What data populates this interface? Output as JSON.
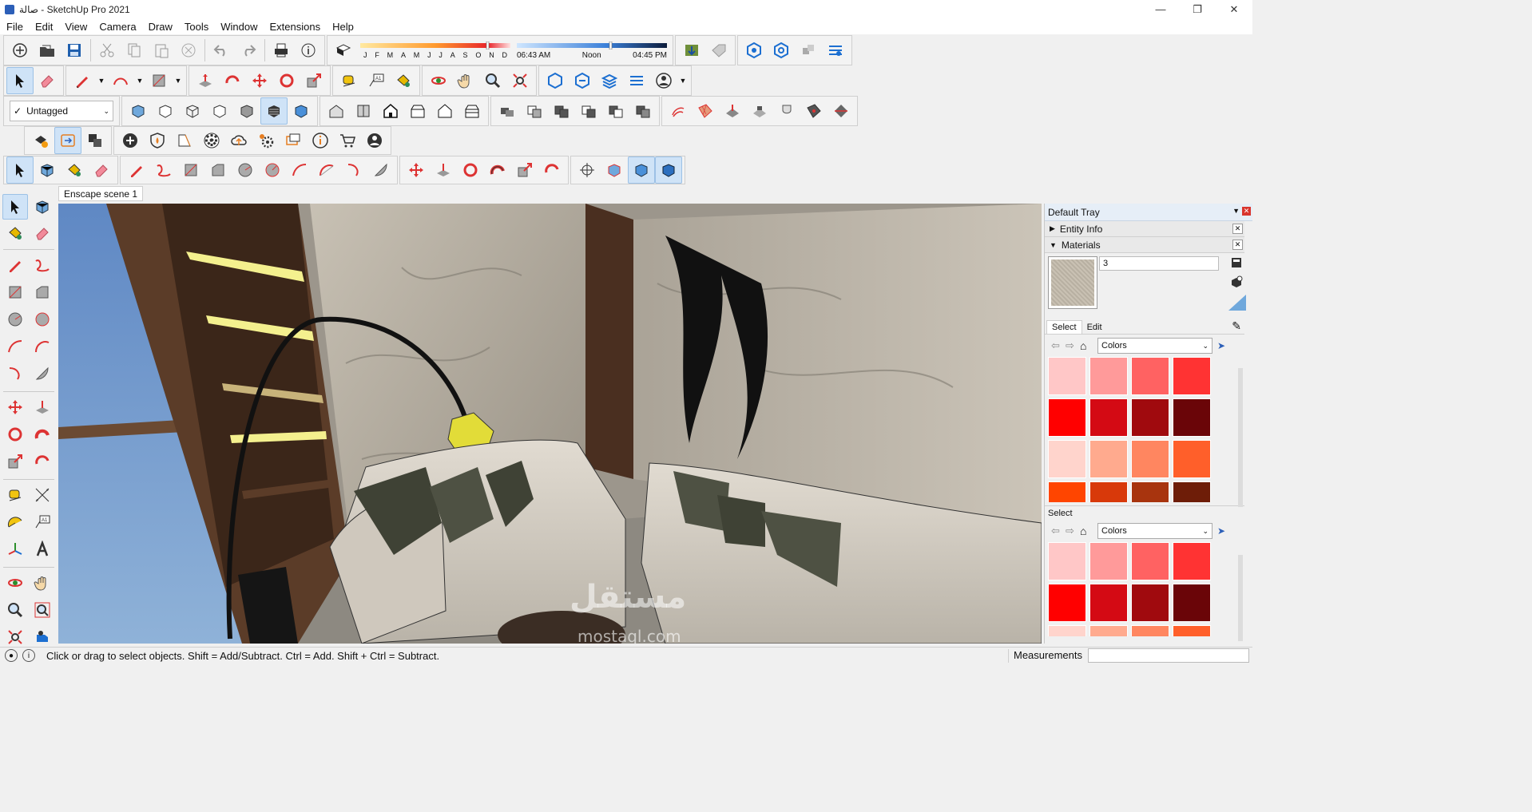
{
  "window": {
    "title": "صالة - SketchUp Pro 2021",
    "controls": [
      "minimize-icon",
      "maximize-icon",
      "close-icon"
    ]
  },
  "menu": [
    "File",
    "Edit",
    "View",
    "Camera",
    "Draw",
    "Tools",
    "Window",
    "Extensions",
    "Help"
  ],
  "shadows": {
    "months": [
      "J",
      "F",
      "M",
      "A",
      "M",
      "J",
      "J",
      "A",
      "S",
      "O",
      "N",
      "D"
    ],
    "time_start": "06:43 AM",
    "time_mid": "Noon",
    "time_end": "04:45 PM"
  },
  "tag_dropdown": {
    "value": "Untagged"
  },
  "scene_tab": "Enscape scene 1",
  "tray": {
    "title": "Default Tray",
    "panels": [
      "Entity Info",
      "Materials"
    ],
    "material_name": "3",
    "tabs": [
      "Select",
      "Edit"
    ],
    "library": "Colors",
    "second_select_label": "Select",
    "second_library": "Colors",
    "swatches_top": [
      "#ffc7c7",
      "#ff9a9a",
      "#ff6262",
      "#ff3333",
      "#ff0000",
      "#d40a14",
      "#a00a0e",
      "#6a0508",
      "#ffd4cc",
      "#ffaa8e",
      "#ff8660",
      "#ff5f2a",
      "#ff4500",
      "#d8390a",
      "#a8340e",
      "#6e1d08"
    ],
    "swatches_bottom": [
      "#ffc7c7",
      "#ff9a9a",
      "#ff6262",
      "#ff3333",
      "#ff0000",
      "#d40a14",
      "#a00a0e",
      "#6a0508",
      "#ffd4cc",
      "#ffaa8e",
      "#ff8660",
      "#ff5f2a"
    ]
  },
  "status": {
    "hint": "Click or drag to select objects. Shift = Add/Subtract. Ctrl = Add. Shift + Ctrl = Subtract.",
    "measurements_label": "Measurements",
    "measurements_value": ""
  },
  "watermark": {
    "arabic": "مستقل",
    "latin": "mostaql.com"
  }
}
